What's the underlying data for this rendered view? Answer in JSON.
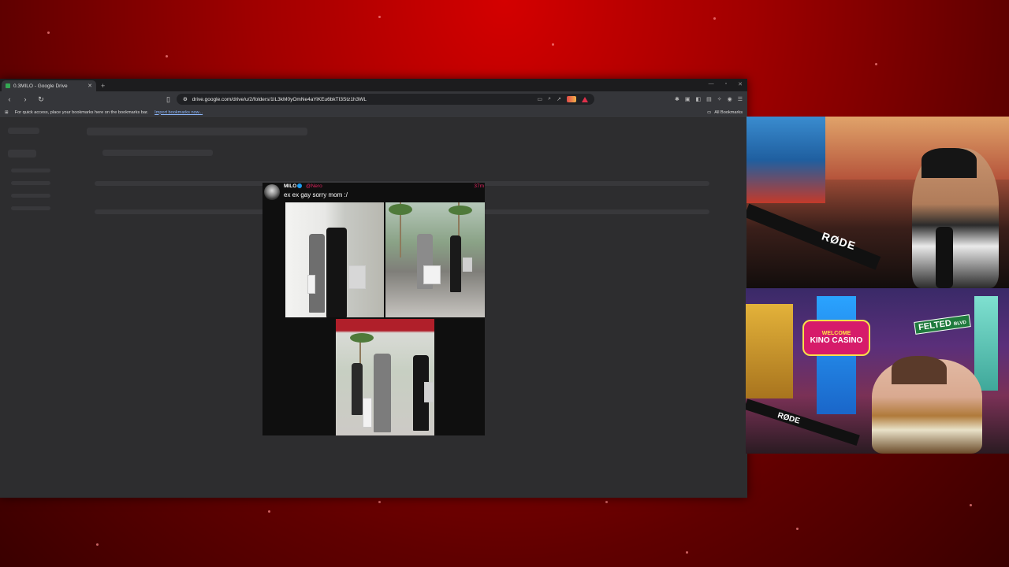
{
  "browser": {
    "tab_title": "0.3MILO - Google Drive",
    "new_tab_icon": "plus-icon",
    "url": "drive.google.com/drive/u/2/folders/1IL3kM0yOmNe4aYiKEu6bkTI3Stz1h3WL",
    "bookmarks_hint": "For quick access, place your bookmarks here on the bookmarks bar.",
    "import_link": "Import bookmarks now...",
    "all_bookmarks": "All Bookmarks"
  },
  "tweet": {
    "name": "MILO",
    "handle": "@Nero",
    "time": "37m",
    "text": "ex ex gay sorry mom :/"
  },
  "cam1": {
    "mic_brand": "RØDE"
  },
  "cam2": {
    "sign_welcome": "WELCOME",
    "sign_casino": "KINO CASINO",
    "sign_street": "FELTED",
    "sign_street_suffix": "BLVD",
    "mic_brand": "RØDE"
  },
  "colors": {
    "background": "#a00000",
    "handle": "#e0245e",
    "verified": "#1d9bf0",
    "link": "#8ab4f8"
  }
}
